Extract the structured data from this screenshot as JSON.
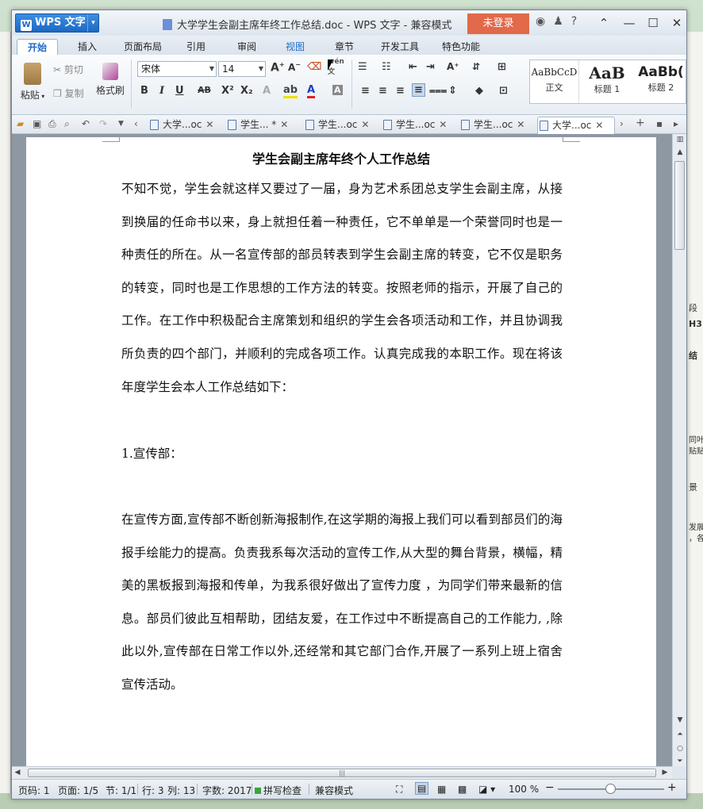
{
  "app": {
    "logo_label": "WPS 文字",
    "window_title": "大学学生会副主席年终工作总结.doc - WPS 文字 - 兼容模式",
    "login_label": "未登录"
  },
  "menu_tabs": [
    "开始",
    "插入",
    "页面布局",
    "引用",
    "审阅",
    "视图",
    "章节",
    "开发工具",
    "特色功能"
  ],
  "ribbon": {
    "paste": "粘贴",
    "cut": "剪切",
    "copy": "复制",
    "format_painter": "格式刷",
    "font_name": "宋体",
    "font_size": "14",
    "bold": "B",
    "italic": "I",
    "underline": "U",
    "strike": "AB",
    "superscript": "X²",
    "subscript": "X₂",
    "font_color": "A",
    "styles": [
      {
        "preview": "AaBbCcD",
        "name": "正文"
      },
      {
        "preview": "AaB",
        "name": "标题 1"
      },
      {
        "preview": "AaBb(",
        "name": "标题 2"
      }
    ]
  },
  "doc_tabs": [
    "大学...oc",
    "学生... *",
    "学生...oc",
    "学生...oc",
    "学生...oc",
    "大学...oc"
  ],
  "document": {
    "title": "学生会副主席年终个人工作总结",
    "paragraphs": [
      "不知不觉，学生会就这样又要过了一届，身为艺术系团总支学生会副主席，从接到换届的任命书以来，身上就担任着一种责任，它不单单是一个荣誉同时也是一种责任的所在。从一名宣传部的部员转表到学生会副主席的转变，它不仅是职务的转变，同时也是工作思想的工作方法的转变。按照老师的指示，开展了自己的工作。在工作中积极配合主席策划和组织的学生会各项活动和工作，并且协调我所负责的四个部门，并顺利的完成各项工作。认真完成我的本职工作。现在将该年度学生会本人工作总结如下：",
      "1.宣传部：",
      "在宣传方面,宣传部不断创新海报制作,在这学期的海报上我们可以看到部员们的海报手绘能力的提高。负责我系每次活动的宣传工作,从大型的舞台背景，横幅，精美的黑板报到海报和传单，为我系很好做出了宣传力度 ，为同学们带来最新的信息。部员们彼此互相帮助，团结友爱，在工作过中不断提高自己的工作能力, ,除此以外,宣传部在日常工作以外,还经常和其它部门合作,开展了一系列上班上宿舍宣传活动。"
    ]
  },
  "status": {
    "page_no": "页码: 1",
    "pages": "页面: 1/5",
    "section": "节: 1/1",
    "row": "行: 3",
    "col": "列: 13",
    "words": "字数: 2017",
    "spell": "拼写检查",
    "mode": "兼容模式",
    "zoom": "100 %"
  },
  "right_peek": [
    "段",
    "H3",
    "结",
    "同叶",
    "贴贴",
    "景",
    "发展",
    "，各"
  ],
  "colors": {
    "accent": "#1b6ac9",
    "login_bg": "#e2694a",
    "logo_bg": "#1d68c4"
  }
}
